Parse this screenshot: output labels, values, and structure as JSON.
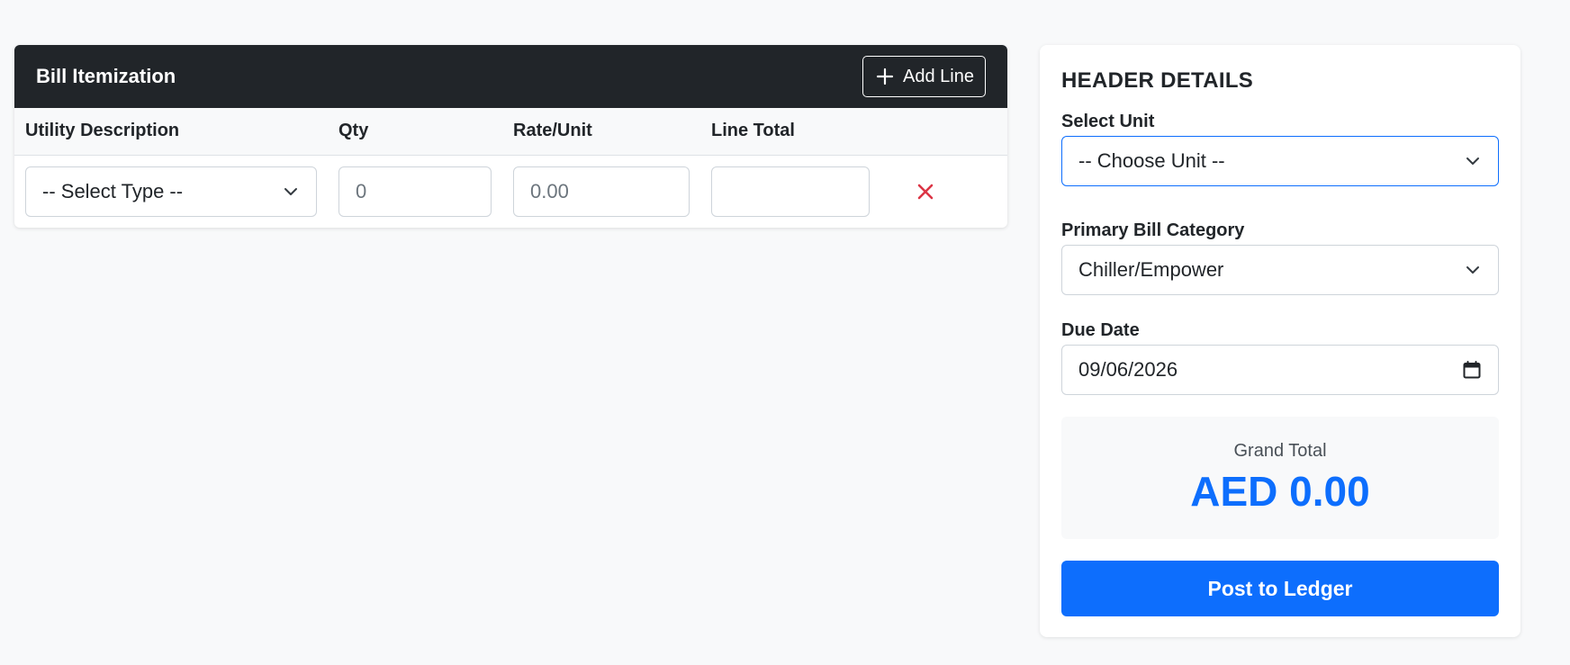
{
  "itemization": {
    "title": "Bill Itemization",
    "add_line_label": "Add Line",
    "columns": [
      "Utility Description",
      "Qty",
      "Rate/Unit",
      "Line Total"
    ],
    "rows": [
      {
        "type_value": "-- Select Type --",
        "qty_placeholder": "0",
        "rate_placeholder": "0.00",
        "line_total": ""
      }
    ]
  },
  "details": {
    "title": "HEADER DETAILS",
    "unit_label": "Select Unit",
    "unit_value": "-- Choose Unit --",
    "category_label": "Primary Bill Category",
    "category_value": "Chiller/Empower",
    "due_date_label": "Due Date",
    "due_date_value": "09/06/2026",
    "grand_total_label": "Grand Total",
    "grand_total_value": "AED 0.00",
    "post_label": "Post to Ledger"
  },
  "colors": {
    "primary": "#0d6efd",
    "dark": "#212529",
    "danger": "#dc3545"
  },
  "icons": {
    "add": "plus-icon",
    "dropdown": "chevron-down-icon",
    "remove": "x-icon",
    "calendar": "calendar-icon"
  }
}
